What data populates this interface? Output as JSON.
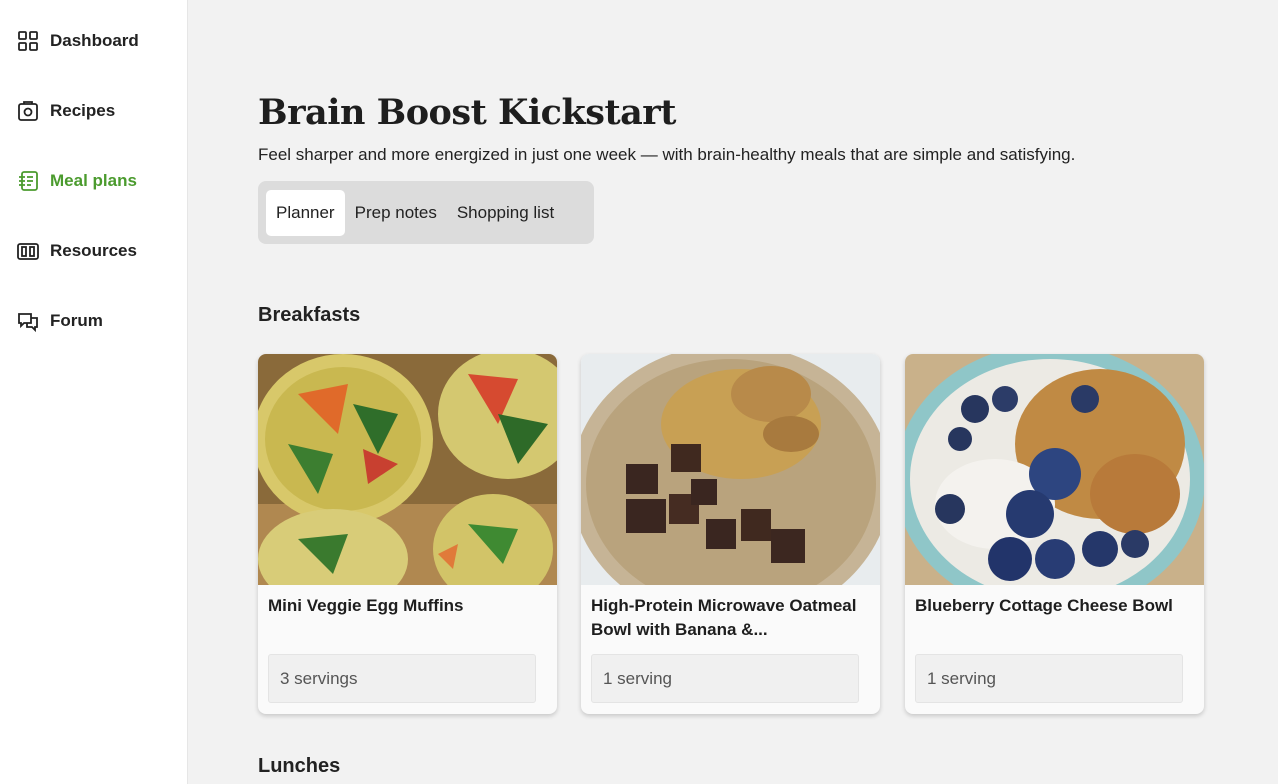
{
  "sidebar": {
    "items": [
      {
        "label": "Dashboard",
        "icon": "dashboard-icon",
        "active": false
      },
      {
        "label": "Recipes",
        "icon": "recipes-icon",
        "active": false
      },
      {
        "label": "Meal plans",
        "icon": "meal-plans-icon",
        "active": true
      },
      {
        "label": "Resources",
        "icon": "resources-icon",
        "active": false
      },
      {
        "label": "Forum",
        "icon": "forum-icon",
        "active": false
      }
    ],
    "active_color": "#4b9b2e"
  },
  "main": {
    "title": "Brain Boost Kickstart",
    "subtitle": "Feel sharper and more energized in just one week — with brain-healthy meals that are simple and satisfying.",
    "tabs": [
      {
        "label": "Planner",
        "active": true
      },
      {
        "label": "Prep notes",
        "active": false
      },
      {
        "label": "Shopping list",
        "active": false
      }
    ],
    "sections": {
      "breakfasts": {
        "title": "Breakfasts",
        "cards": [
          {
            "title": "Mini Veggie Egg Muffins",
            "servings": "3 servings",
            "image": "egg-muffins-photo"
          },
          {
            "title": "High-Protein Microwave Oatmeal Bowl with Banana &...",
            "servings": "1 serving",
            "image": "oatmeal-bowl-photo"
          },
          {
            "title": "Blueberry Cottage Cheese Bowl",
            "servings": "1 serving",
            "image": "blueberry-bowl-photo"
          }
        ]
      },
      "lunches": {
        "title": "Lunches"
      }
    }
  }
}
